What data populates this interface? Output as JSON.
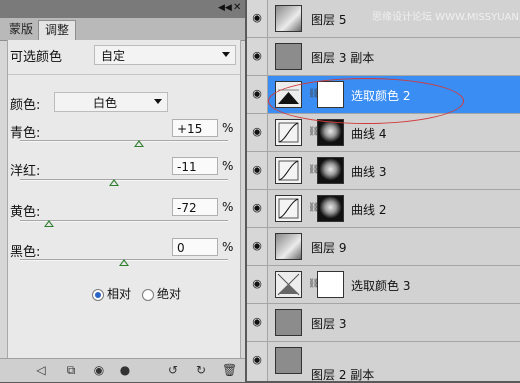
{
  "watermark": "思缘设计论坛 WWW.MISSYUAN.COM",
  "panel": {
    "tabs": [
      "蒙版",
      "调整"
    ],
    "title_label": "可选颜色",
    "preset_value": "自定",
    "colors_label": "颜色:",
    "colors_value": "白色",
    "sliders": [
      {
        "label": "青色:",
        "value": "+15",
        "unit": "%",
        "level": 0.57
      },
      {
        "label": "洋红:",
        "value": "-11",
        "unit": "%",
        "level": 0.45
      },
      {
        "label": "黄色:",
        "value": "-72",
        "unit": "%",
        "level": 0.14
      },
      {
        "label": "黑色:",
        "value": "0",
        "unit": "%",
        "level": 0.5
      }
    ],
    "method": {
      "relative": "相对",
      "absolute": "绝对",
      "selected": "relative"
    },
    "bottom_icons": [
      "back-arrow-icon",
      "clip-icon",
      "mask-icon",
      "eye-icon",
      "reset-icon",
      "refresh-icon",
      "trash-icon"
    ]
  },
  "layers": [
    {
      "name": "图层 5",
      "thumb": "photo",
      "selected": false
    },
    {
      "name": "图层 3 副本",
      "thumb": "gray",
      "selected": false
    },
    {
      "name": "选取颜色 2",
      "thumb": "selective-color",
      "mask": "mask",
      "selected": true
    },
    {
      "name": "曲线 4",
      "thumb": "curve",
      "mask": "mask",
      "selected": false
    },
    {
      "name": "曲线 3",
      "thumb": "curve",
      "mask": "mask",
      "selected": false
    },
    {
      "name": "曲线 2",
      "thumb": "curve",
      "mask": "mask",
      "selected": false
    },
    {
      "name": "图层 9",
      "thumb": "photo",
      "selected": false
    },
    {
      "name": "选取颜色 3",
      "thumb": "selective-color",
      "mask": "white",
      "selected": false
    },
    {
      "name": "图层 3",
      "thumb": "gray",
      "selected": false
    },
    {
      "name": "图层 2 副本",
      "thumb": "gray",
      "selected": false
    }
  ]
}
